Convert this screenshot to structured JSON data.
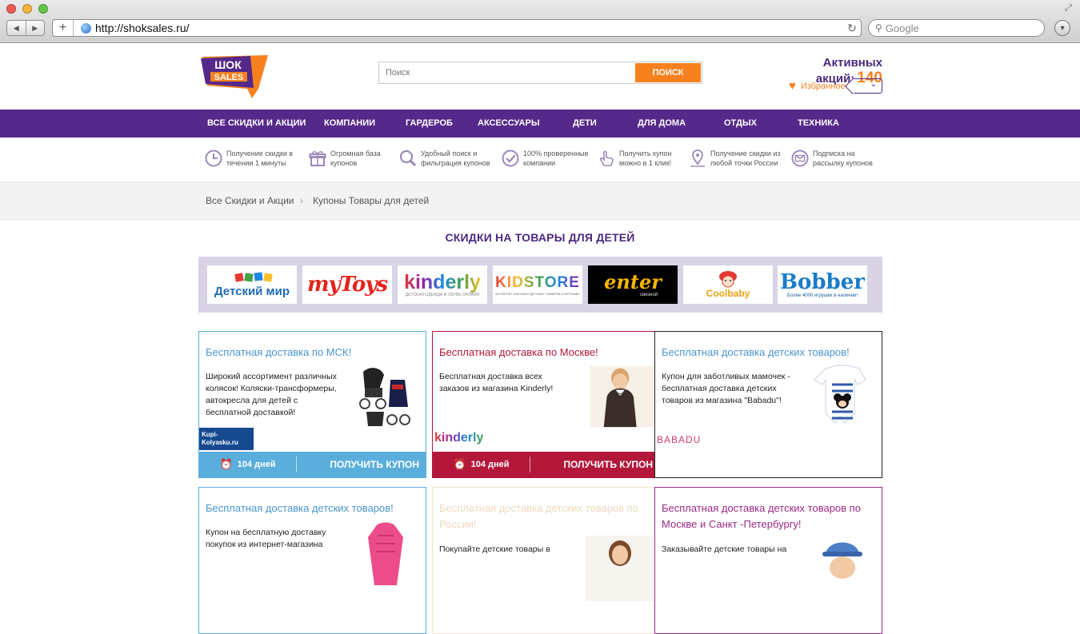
{
  "browser": {
    "url": "http://shoksales.ru/",
    "search_placeholder": "Google"
  },
  "header": {
    "logo_top": "ШОК",
    "logo_bottom": "SALES",
    "search_placeholder": "Поиск",
    "search_button": "ПОИСК",
    "active_label": "Активных акций:",
    "active_count": "140",
    "favorites": "Избранное"
  },
  "nav": [
    "ВСЕ СКИДКИ И АКЦИИ",
    "КОМПАНИИ",
    "ГАРДЕРОБ",
    "АКСЕССУАРЫ",
    "ДЕТИ",
    "ДЛЯ ДОМА",
    "ОТДЫХ",
    "ТЕХНИКА"
  ],
  "features": [
    {
      "icon": "clock-icon",
      "text": "Получение скидки в\nтечении 1 минуты"
    },
    {
      "icon": "gift-icon",
      "text": "Огромная база\nкупонов"
    },
    {
      "icon": "magnifier-icon",
      "text": "Удобный поиск и\nфильтрация купонов"
    },
    {
      "icon": "checkmark-icon",
      "text": "100% проверенные\nкомпании"
    },
    {
      "icon": "hand-click-icon",
      "text": "Получить купон\nможно в 1 клик!"
    },
    {
      "icon": "map-pin-icon",
      "text": "Получение скидки из\nлюбой точки России"
    },
    {
      "icon": "envelope-icon",
      "text": "Подписка на\nрассылку купонов"
    }
  ],
  "breadcrumb": {
    "home": "Все Скидки и Акции",
    "separator": "›",
    "current": "Купоны Товары для детей"
  },
  "section_title": "СКИДКИ НА ТОВАРЫ ДЛЯ ДЕТЕЙ",
  "brands": [
    {
      "name": "Детский мир",
      "logo": "Детский мир"
    },
    {
      "name": "myToys",
      "logo": "myToys"
    },
    {
      "name": "kinderly",
      "logo": "kinderly",
      "tagline": "ДЕТСКАЯ ОДЕЖДА И ОБУВЬ ОНЛАЙН"
    },
    {
      "name": "KIDSTORE",
      "logo": "KIDSTORE",
      "tagline": "ИНТЕРНЕТ-МАГАЗИН ДЕТСКИХ ТОВАРОВ И ИГРУШЕК"
    },
    {
      "name": "enter",
      "logo": "enter",
      "tagline": "связной"
    },
    {
      "name": "Coolbaby",
      "logo": "Coolbaby"
    },
    {
      "name": "Bobber",
      "logo": "Bobber",
      "tagline": "Более 4000 игрушек в наличии!"
    }
  ],
  "cards": [
    {
      "title": "Бесплатная доставка по МСК!",
      "desc": "Широкий ассортимент различных колясок! Коляски-трансформеры, автокресла для детей с бесплатной доставкой!",
      "store_logo": "Kupi-Kolyasku.ru",
      "image": "stroller-image",
      "days": "104 дней",
      "cta": "ПОЛУЧИТЬ КУПОН",
      "accent": "#5aaedc",
      "title_color": "#4a95cf"
    },
    {
      "title": "Бесплатная доставка по Москве!",
      "desc": "Бесплатная доставка всех заказов из магазина Kinderly!",
      "store_logo": "kinderly",
      "image": "boy-image",
      "days": "104 дней",
      "cta": "ПОЛУЧИТЬ КУПОН",
      "accent": "#b3183b",
      "title_color": "#b3183b"
    },
    {
      "title": "Бесплатная доставка детских товаров!",
      "desc": "Купон для заботливых мамочек - бесплатная доставка детских товаров из магазина \"Babadu\"!",
      "store_logo": "BABADU",
      "image": "baby-romper-image",
      "accent": "#222222",
      "title_color": "#4a95cf"
    },
    {
      "title": "Бесплатная доставка детских товаров!",
      "desc": "Купон на бесплатную доставку покупок из интернет-магазина",
      "image": "pink-jacket-image",
      "accent": "#5aaedc",
      "title_color": "#4a95cf"
    },
    {
      "title": "Бесплатная доставка детских товаров по России!",
      "desc": "Покупайте детские товары в",
      "image": "girl-image",
      "accent": "#f2e3cf",
      "title_color": "#ecd9bf"
    },
    {
      "title": "Бесплатная доставка детских товаров по Москве и Санкт -Петербургу!",
      "desc": "Заказывайте детские товары на",
      "image": "kid-hat-image",
      "accent": "#9b2a85",
      "title_color": "#9b2a85"
    }
  ]
}
